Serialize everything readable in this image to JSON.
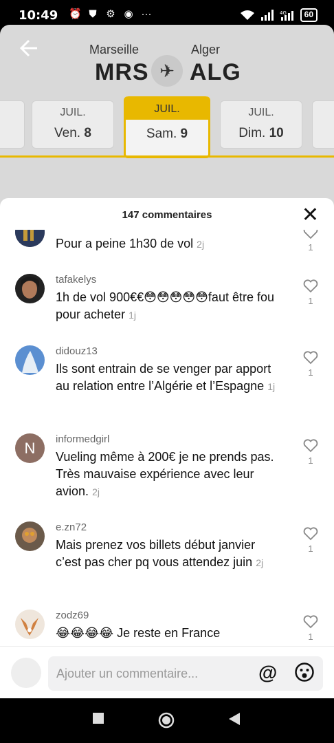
{
  "status_bar": {
    "time": "10:49",
    "battery": "60",
    "icons": [
      "alarm-icon",
      "shield-icon",
      "settings-icon",
      "messenger-icon",
      "more-icon",
      "wifi-icon",
      "signal-icon",
      "signal-4g-icon"
    ]
  },
  "flight": {
    "from_city": "Marseille",
    "from_code": "MRS",
    "to_city": "Alger",
    "to_code": "ALG",
    "dates": [
      {
        "month": "JUIL.",
        "day_label": "Ven.",
        "day_num": "8"
      },
      {
        "month": "JUIL.",
        "day_label": "Sam.",
        "day_num": "9",
        "selected": true
      },
      {
        "month": "JUIL.",
        "day_label": "Dim.",
        "day_num": "10"
      }
    ],
    "accent": "#e8b800"
  },
  "comments_sheet": {
    "title": "147 commentaires",
    "comments": [
      {
        "username": "",
        "text": "Pour a peine 1h30 de vol",
        "age": "2j",
        "likes": "1"
      },
      {
        "username": "tafakelys",
        "text": "1h de vol 900€€😳😳😳😳😳faut être fou pour acheter",
        "age": "1j",
        "likes": "1"
      },
      {
        "username": "didouz13",
        "text": "Ils sont entrain de se venger par apport au relation entre l’Algérie et l’Espagne",
        "age": "1j",
        "likes": "1"
      },
      {
        "username": "informedgirl",
        "avatar_letter": "N",
        "text": "Vueling même à 200€ je ne prends pas. Très mauvaise expérience avec leur avion.",
        "age": "2j",
        "likes": "1"
      },
      {
        "username": "e.zn72",
        "text": "Mais prenez vos billets début janvier c’est pas cher pq vous attendez juin",
        "age": "2j",
        "likes": "1"
      },
      {
        "username": "zodz69",
        "text": "😂😂😂😂 Je reste en France",
        "age": "",
        "likes": "1"
      }
    ],
    "composer_placeholder": "Ajouter un commentaire..."
  }
}
